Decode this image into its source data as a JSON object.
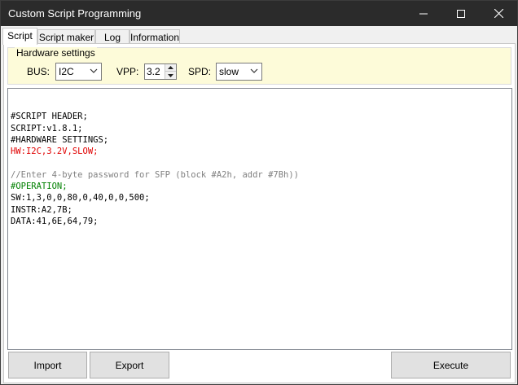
{
  "window": {
    "title": "Custom Script Programming"
  },
  "tabs": [
    {
      "label": "Script",
      "active": true
    },
    {
      "label": "Script maker",
      "active": false
    },
    {
      "label": "Log",
      "active": false
    },
    {
      "label": "Information",
      "active": false
    }
  ],
  "hardware": {
    "legend": "Hardware settings",
    "bus_label": "BUS:",
    "bus_value": "I2C",
    "vpp_label": "VPP:",
    "vpp_value": "3.2",
    "spd_label": "SPD:",
    "spd_value": "slow"
  },
  "script": {
    "lines": [
      {
        "text": "",
        "color": "#000000"
      },
      {
        "text": "#SCRIPT HEADER;",
        "color": "#000000"
      },
      {
        "text": "SCRIPT:v1.8.1;",
        "color": "#000000"
      },
      {
        "text": "#HARDWARE SETTINGS;",
        "color": "#000000"
      },
      {
        "text": "HW:I2C,3.2V,SLOW;",
        "color": "#e00000"
      },
      {
        "text": "",
        "color": "#000000"
      },
      {
        "text": "//Enter 4-byte password for SFP (block #A2h, addr #7Bh))",
        "color": "#808080"
      },
      {
        "text": "#OPERATION;",
        "color": "#008000"
      },
      {
        "text": "SW:1,3,0,0,80,0,40,0,0,500;",
        "color": "#000000"
      },
      {
        "text": "INSTR:A2,7B;",
        "color": "#000000"
      },
      {
        "text": "DATA:41,6E,64,79;",
        "color": "#000000"
      }
    ]
  },
  "buttons": {
    "import": "Import",
    "export": "Export",
    "execute": "Execute"
  },
  "colors": {
    "titlebar": "#2b2b2b",
    "hw_panel": "#fdfbd9",
    "error_red": "#e00000",
    "comment_gray": "#808080",
    "section_green": "#008000"
  }
}
